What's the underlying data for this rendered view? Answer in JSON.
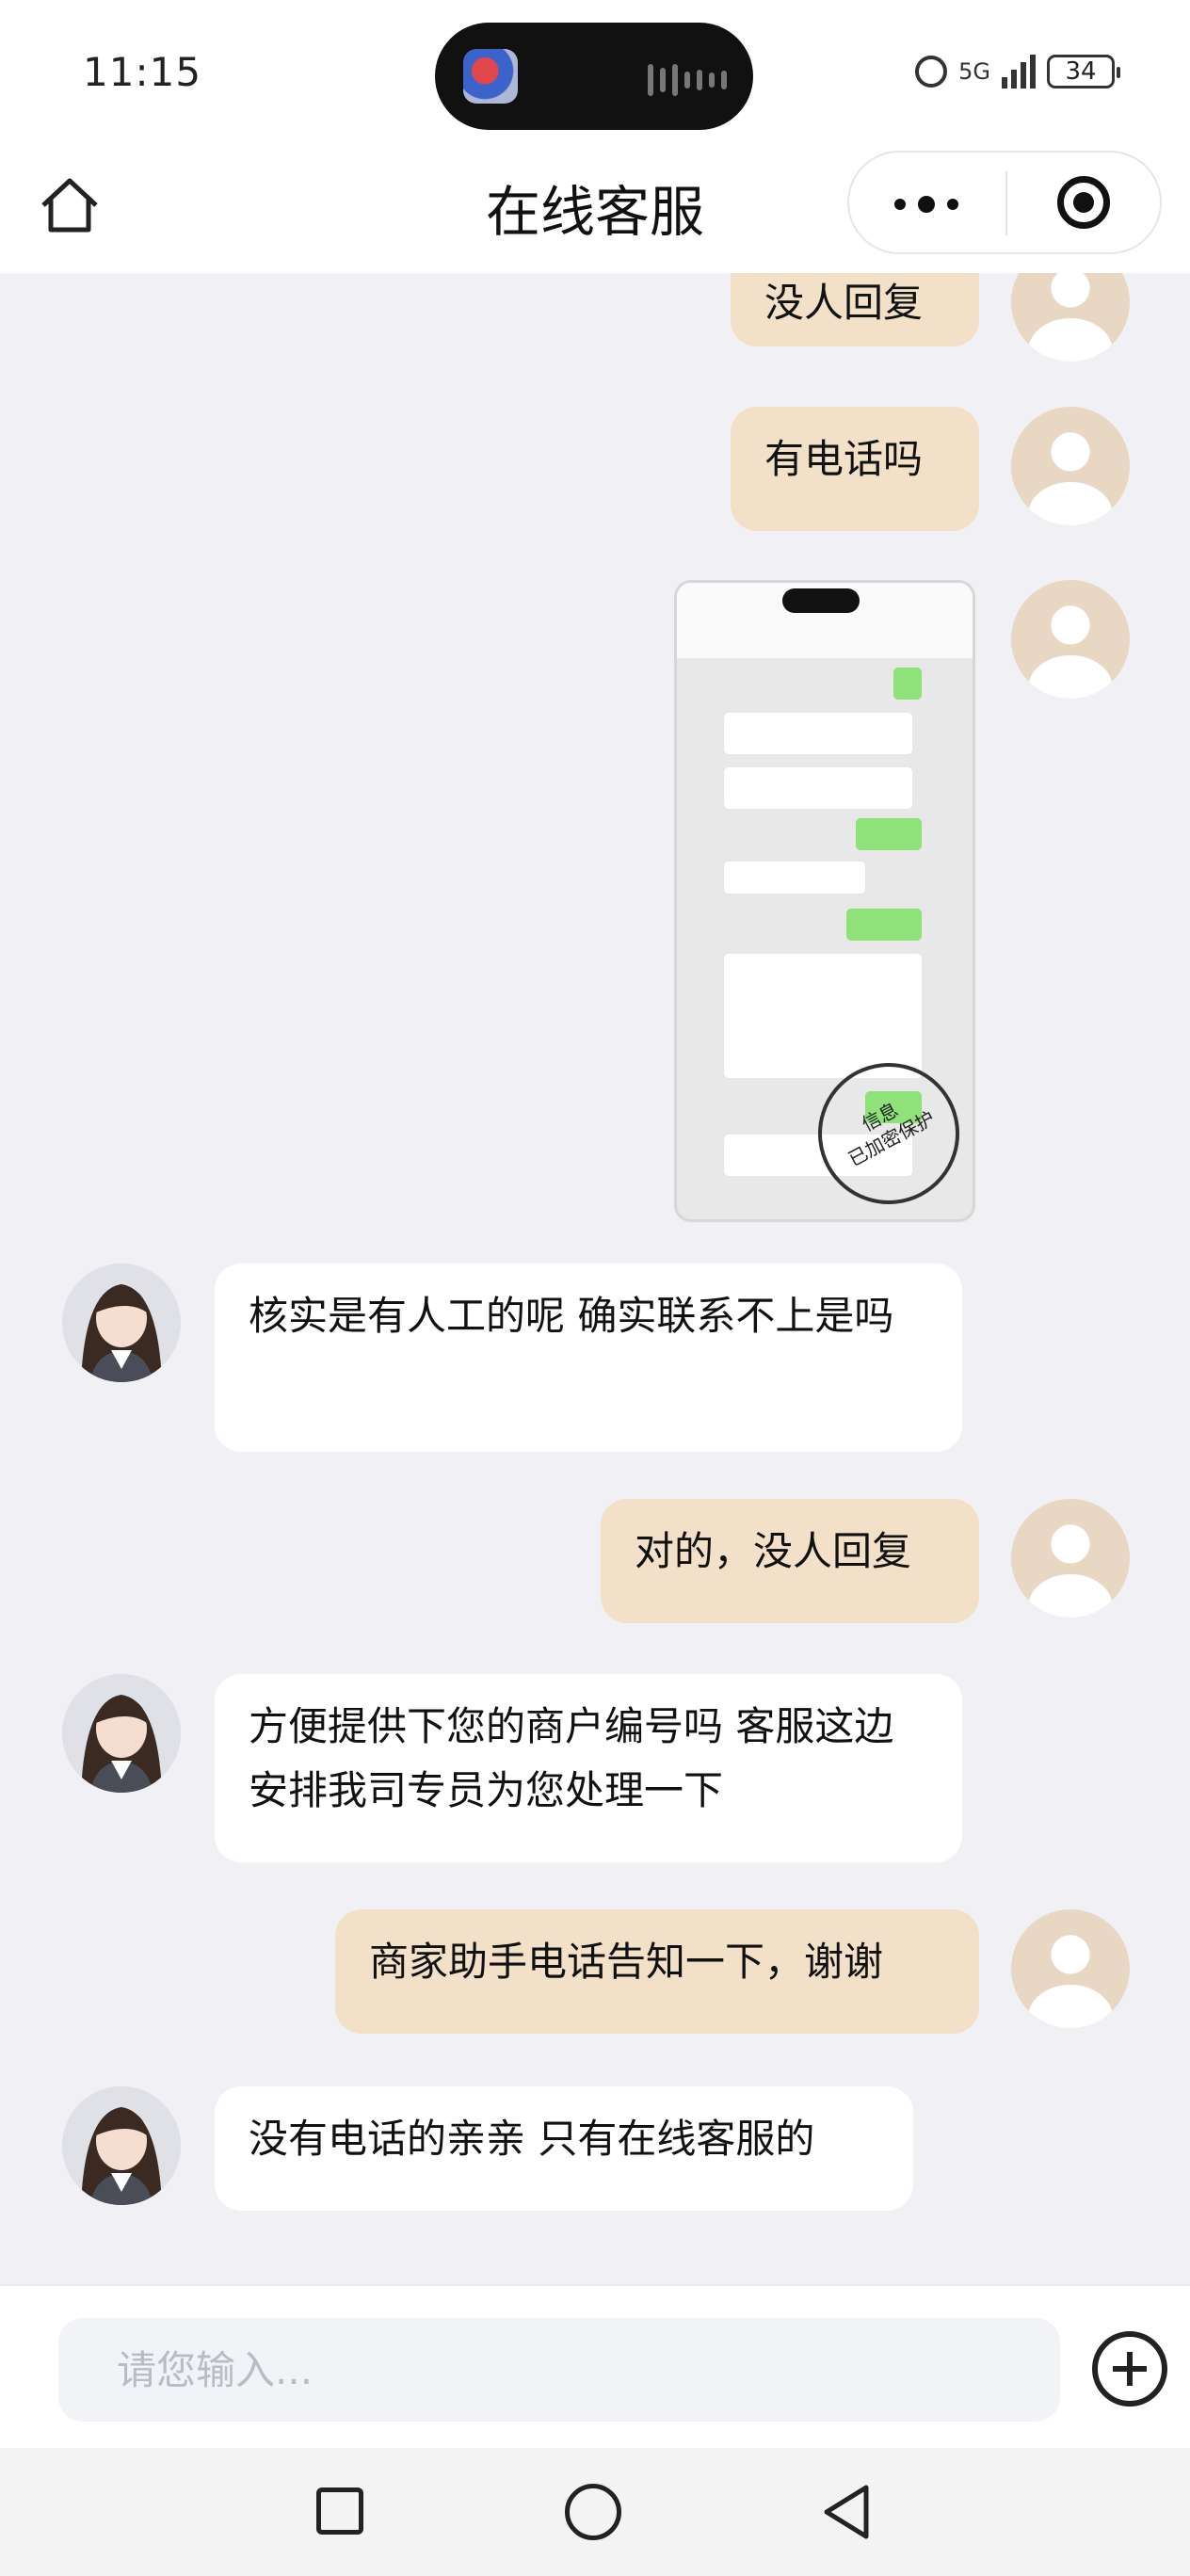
{
  "status_bar": {
    "time": "11:15",
    "network": "5G",
    "battery": "34"
  },
  "header": {
    "title": "在线客服",
    "home_icon": "home-icon",
    "more_icon": "more-dots-icon",
    "close_icon": "target-circle-icon"
  },
  "messages": [
    {
      "side": "out",
      "text": "没人回复"
    },
    {
      "side": "out",
      "text": "有电话吗"
    },
    {
      "side": "out",
      "type": "image"
    },
    {
      "side": "in",
      "text": "核实是有人工的呢 确实联系不上是吗"
    },
    {
      "side": "out",
      "text": "对的，没人回复"
    },
    {
      "side": "in",
      "text": "方便提供下您的商户编号吗 客服这边安排我司专员为您处理一下"
    },
    {
      "side": "out",
      "text": "商家助手电话告知一下，谢谢"
    },
    {
      "side": "in",
      "text": "没有电话的亲亲 只有在线客服的"
    }
  ],
  "image_stamp": {
    "line1": "信息",
    "line2": "已加密保护"
  },
  "composer": {
    "placeholder": "请您输入..."
  },
  "colors": {
    "outgoing_bubble": "#f2e0c8",
    "incoming_bubble": "#ffffff",
    "background": "#f1f1f5"
  }
}
